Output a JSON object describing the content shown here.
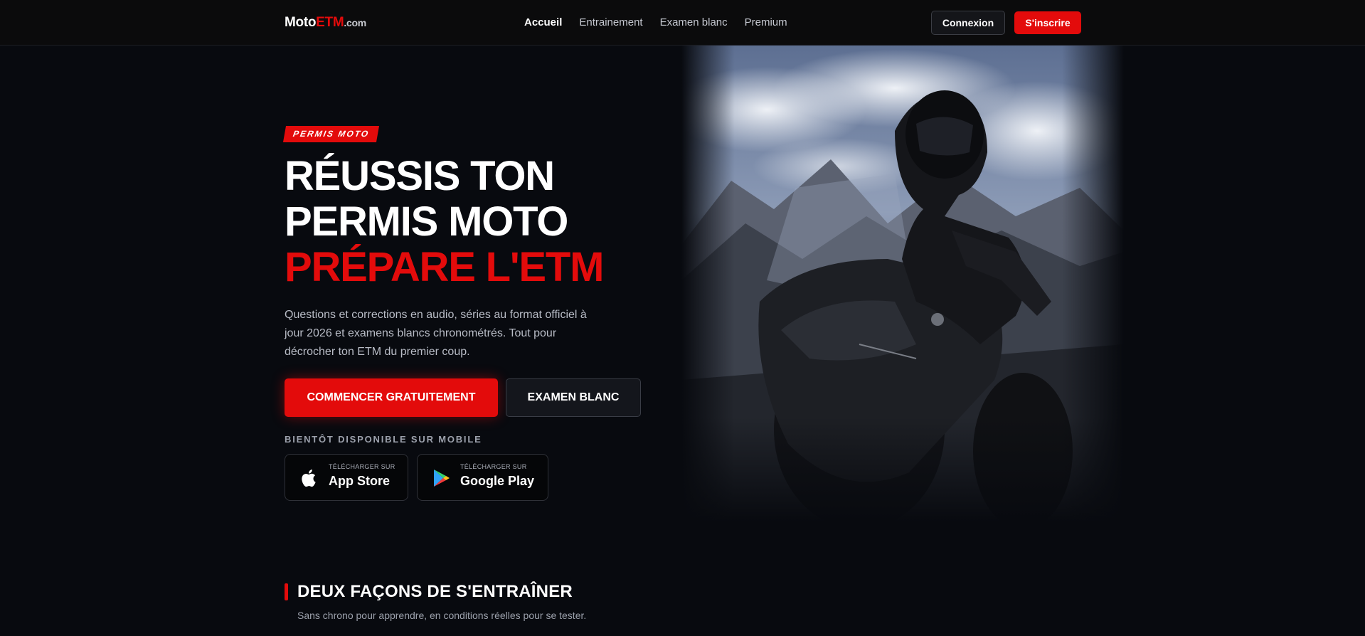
{
  "nav": {
    "logo": {
      "part1": "Moto",
      "part2": "ETM",
      "part3": ".com"
    },
    "links": [
      {
        "label": "Accueil",
        "active": true
      },
      {
        "label": "Entrainement",
        "active": false
      },
      {
        "label": "Examen blanc",
        "active": false
      },
      {
        "label": "Premium",
        "active": false
      }
    ],
    "login_label": "Connexion",
    "signup_label": "S'inscrire"
  },
  "hero": {
    "badge": "PERMIS MOTO",
    "title_line1": "RÉUSSIS TON",
    "title_line2": "PERMIS MOTO",
    "title_line3": "PRÉPARE L'ETM",
    "description": "Questions et corrections en audio, séries au format officiel à jour 2026 et examens blancs chronométrés. Tout pour décrocher ton ETM du premier coup.",
    "cta_primary": "COMMENCER GRATUITEMENT",
    "cta_secondary": "EXAMEN BLANC",
    "mobile_label": "BIENTÔT DISPONIBLE SUR MOBILE",
    "app_store": {
      "small": "TÉLÉCHARGER SUR",
      "big": "App Store",
      "icon": "apple-icon"
    },
    "google_play": {
      "small": "TÉLÉCHARGER SUR",
      "big": "Google Play",
      "icon": "google-play-icon"
    }
  },
  "section": {
    "title": "DEUX FAÇONS DE S'ENTRAÎNER",
    "subtitle": "Sans chrono pour apprendre, en conditions réelles pour se tester."
  },
  "colors": {
    "accent": "#e30b0b",
    "background": "#080a0f",
    "navbar": "#0b0b0c"
  }
}
